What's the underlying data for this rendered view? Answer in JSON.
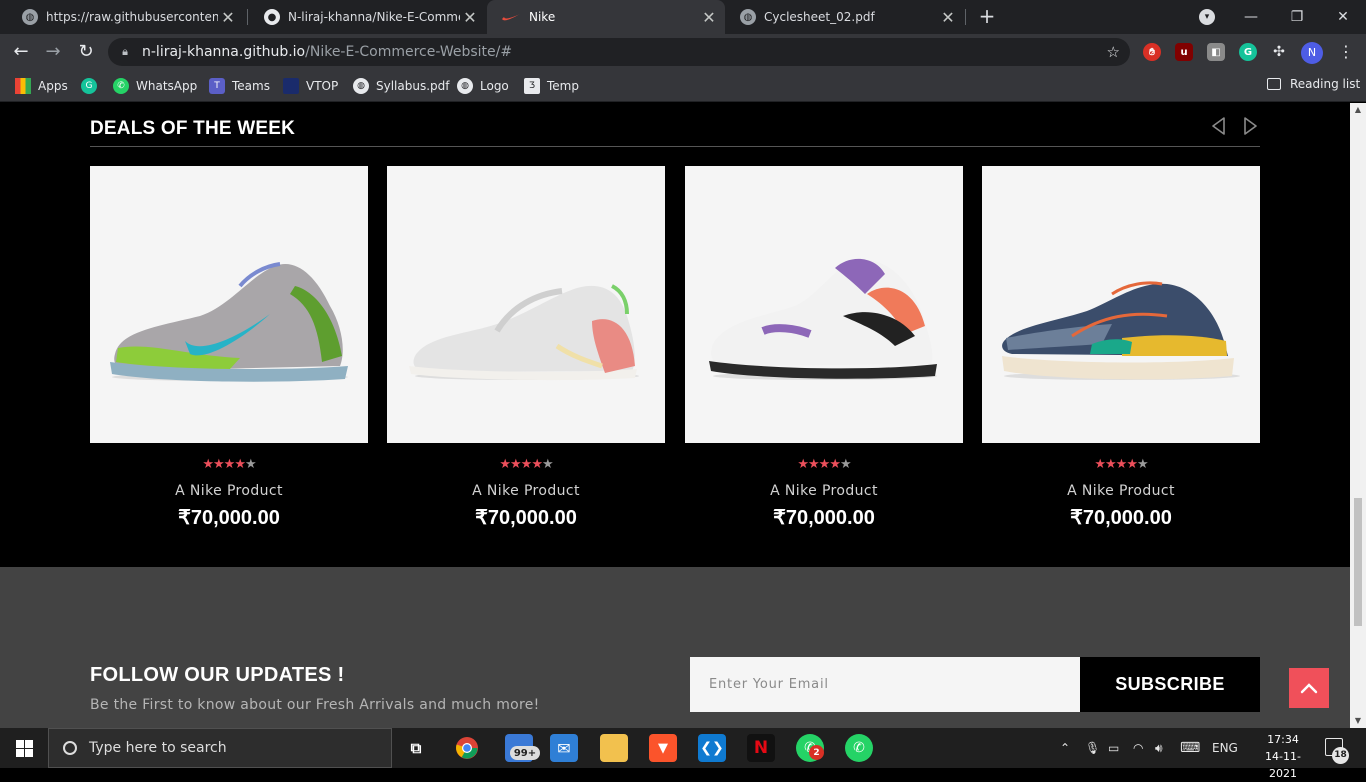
{
  "tabs": [
    {
      "title": "https://raw.githubusercontent.co",
      "icon": "globe-icon"
    },
    {
      "title": "N-liraj-khanna/Nike-E-Commerce",
      "icon": "github-icon"
    },
    {
      "title": "Nike",
      "icon": "nike-swoosh-icon"
    },
    {
      "title": "Cyclesheet_02.pdf",
      "icon": "globe-icon"
    }
  ],
  "tab_close": "✕",
  "address": {
    "host": "n-liraj-khanna.github.io",
    "path": "/Nike-E-Commerce-Website/#"
  },
  "profile_initial": "N",
  "bookmarks": [
    {
      "label": "Apps"
    },
    {
      "label": ""
    },
    {
      "label": "WhatsApp"
    },
    {
      "label": "Teams"
    },
    {
      "label": "VTOP"
    },
    {
      "label": "Syllabus.pdf"
    },
    {
      "label": "Logo"
    },
    {
      "label": "Temp"
    }
  ],
  "reading_list": "Reading list",
  "deals": {
    "title": "DEALS OF THE WEEK",
    "products": [
      {
        "name": "A Nike Product",
        "price": "₹70,000.00",
        "rating": 4,
        "max_rating": 5
      },
      {
        "name": "A Nike Product",
        "price": "₹70,000.00",
        "rating": 4,
        "max_rating": 5
      },
      {
        "name": "A Nike Product",
        "price": "₹70,000.00",
        "rating": 4,
        "max_rating": 5
      },
      {
        "name": "A Nike Product",
        "price": "₹70,000.00",
        "rating": 4,
        "max_rating": 5
      }
    ]
  },
  "newsletter": {
    "title": "FOLLOW OUR UPDATES !",
    "subtitle": "Be the First to know about our Fresh Arrivals and much more!",
    "email_placeholder": "Enter Your Email",
    "subscribe_label": "SUBSCRIBE"
  },
  "colors": {
    "accent": "#f0505a",
    "star": "#ec4f5b",
    "footer_bg": "#434343"
  },
  "taskbar": {
    "search_placeholder": "Type here to search",
    "mail_badge": "99+",
    "whatsapp_badge": "2",
    "language": "ENG",
    "time": "17:34",
    "date": "14-11-2021",
    "notification_count": "18"
  }
}
